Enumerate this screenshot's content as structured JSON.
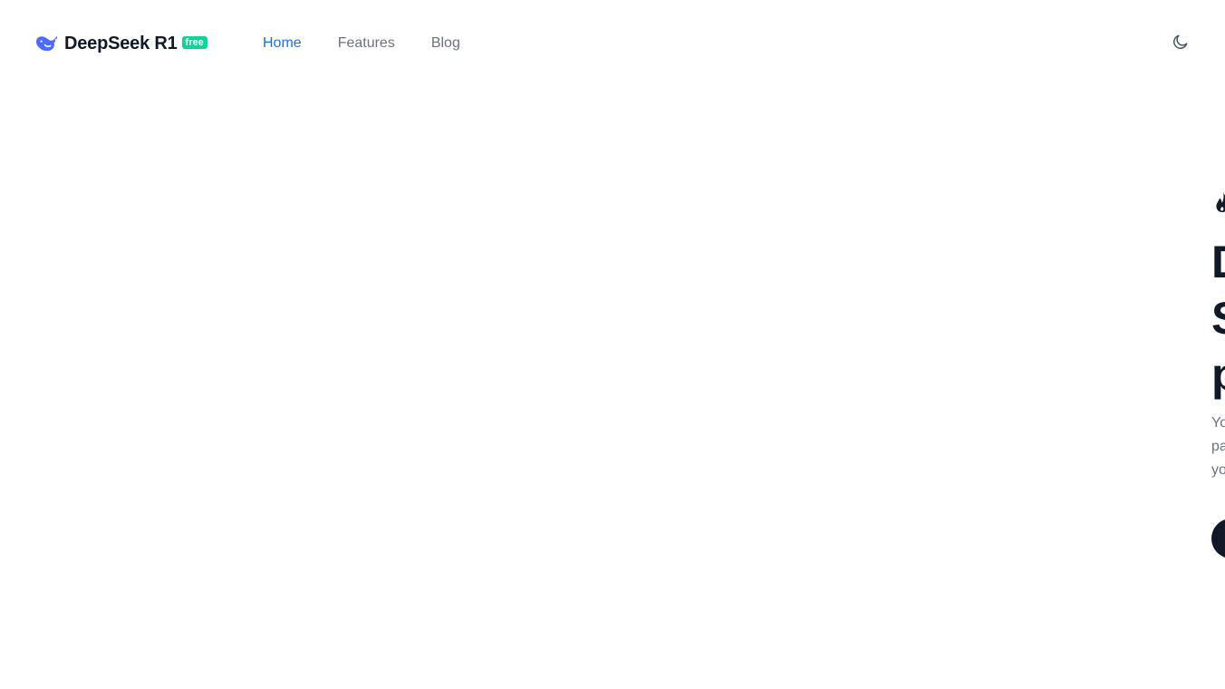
{
  "header": {
    "brand": {
      "name": "DeepSeek R1",
      "badge": "free",
      "logo_icon": "whale-icon"
    },
    "nav": [
      {
        "label": "Home",
        "active": true
      },
      {
        "label": "Features",
        "active": false
      },
      {
        "label": "Blog",
        "active": false
      }
    ],
    "theme_toggle_icon": "moon-icon"
  },
  "hero": {
    "eyebrow_icon": "fire-icon",
    "title_lines": [
      "D",
      "S",
      "p"
    ],
    "description_lines": [
      "Yo",
      "pa",
      "yo"
    ]
  },
  "colors": {
    "accent": "#1d6fe0",
    "badge": "#10d39a",
    "text_dark": "#111827",
    "text_muted": "#6b7280",
    "logo": "#4d6bfe"
  }
}
